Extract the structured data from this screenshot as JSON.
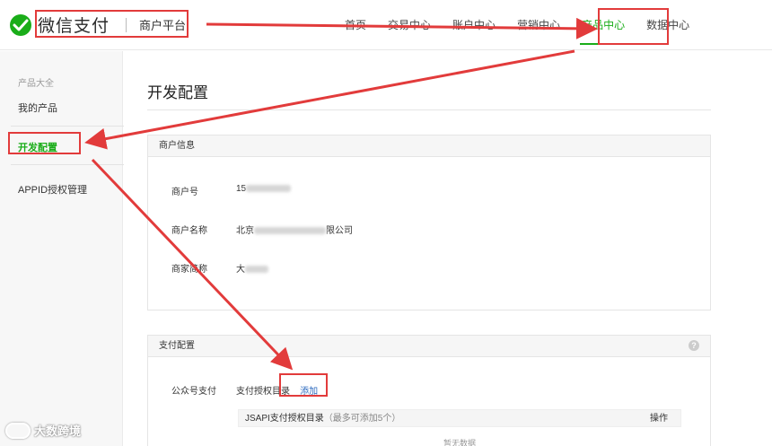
{
  "header": {
    "brand": "微信支付",
    "platform": "商户平台",
    "nav": [
      "首页",
      "交易中心",
      "账户中心",
      "营销中心",
      "产品中心",
      "数据中心"
    ],
    "active_nav": "产品中心"
  },
  "sidebar": {
    "group_label": "产品大全",
    "items": [
      "我的产品",
      "开发配置",
      "APPID授权管理"
    ],
    "active_item": "开发配置"
  },
  "main": {
    "title": "开发配置",
    "merchant_panel": {
      "title": "商户信息",
      "rows": [
        {
          "label": "商户号",
          "value_prefix": "15",
          "value_suffix": ""
        },
        {
          "label": "商户名称",
          "value_prefix": "北京",
          "value_suffix": "限公司"
        },
        {
          "label": "商家简称",
          "value_prefix": "大",
          "value_suffix": ""
        }
      ]
    },
    "pay_panel": {
      "title": "支付配置",
      "help": "?",
      "row_label": "公众号支付",
      "row_value": "支付授权目录",
      "add_label": "添加",
      "table_title": "JSAPI支付授权目录",
      "table_note": "（最多可添加5个）",
      "table_action": "操作",
      "empty_text": "暂无数据"
    }
  },
  "watermark": "大数跨境",
  "colors": {
    "accent": "#1aad19",
    "annotation": "#e23b3b",
    "link": "#2e6bbf"
  }
}
